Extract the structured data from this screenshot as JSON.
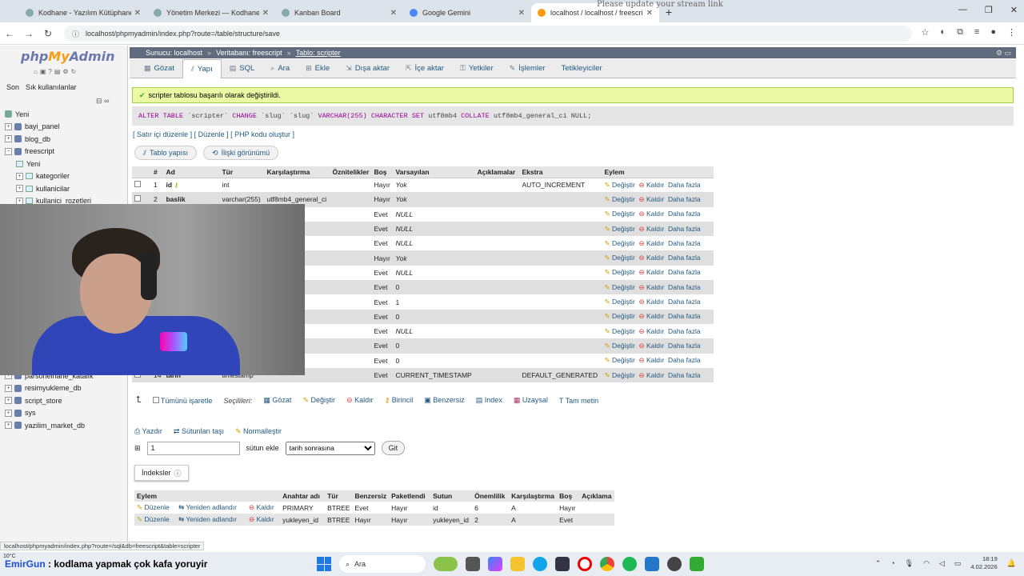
{
  "browser": {
    "tabs": [
      {
        "label": "Kodhane - Yazılım Kütüphanesi",
        "active": false
      },
      {
        "label": "Yönetim Merkezi — Kodhane",
        "active": false
      },
      {
        "label": "Kanban Board",
        "active": false
      },
      {
        "label": "Google Gemini",
        "active": false
      },
      {
        "label": "localhost / localhost / freescri",
        "active": true
      }
    ],
    "stream_note": "Please update your stream link",
    "url": "localhost/phpmyadmin/index.php?route=/table/structure/save",
    "status_url": "localhost/phpmyadmin/index.php?route=/sql&db=freescript&table=scripter"
  },
  "sidebar": {
    "logo_php": "php",
    "logo_my": "My",
    "logo_admin": "Admin",
    "tab_recent": "Son",
    "tab_favorites": "Sık kullanılanlar",
    "tree": [
      {
        "label": "Yeni",
        "level": 0,
        "type": "new"
      },
      {
        "label": "bayi_panel",
        "level": 0,
        "type": "db"
      },
      {
        "label": "blog_db",
        "level": 0,
        "type": "db"
      },
      {
        "label": "freescript",
        "level": 0,
        "type": "db"
      },
      {
        "label": "Yeni",
        "level": 1,
        "type": "new"
      },
      {
        "label": "kategoriler",
        "level": 1,
        "type": "table"
      },
      {
        "label": "kullanicilar",
        "level": 1,
        "type": "table"
      },
      {
        "label": "kullanici_rozetleri",
        "level": 1,
        "type": "table"
      }
    ],
    "tree_bottom": [
      {
        "label": "parsonelhane_katalık",
        "level": 0
      },
      {
        "label": "resimyukleme_db",
        "level": 0
      },
      {
        "label": "script_store",
        "level": 0
      },
      {
        "label": "sys",
        "level": 0
      },
      {
        "label": "yazilim_market_db",
        "level": 0
      }
    ]
  },
  "breadcrumb": {
    "server": "Sunucu: localhost",
    "database": "Veritabanı: freescript",
    "table": "Tablo: scripter"
  },
  "menu": [
    {
      "label": "Gözat",
      "icon": "▦"
    },
    {
      "label": "Yapı",
      "icon": "⫽",
      "active": true
    },
    {
      "label": "SQL",
      "icon": "▤"
    },
    {
      "label": "Ara",
      "icon": "⌕"
    },
    {
      "label": "Ekle",
      "icon": "⊞"
    },
    {
      "label": "Dışa aktar",
      "icon": "⇲"
    },
    {
      "label": "İçe aktar",
      "icon": "⇱"
    },
    {
      "label": "Yetkiler",
      "icon": "⚿"
    },
    {
      "label": "İşlemler",
      "icon": "✎"
    },
    {
      "label": "Tetikleyiciler",
      "icon": ""
    }
  ],
  "message": {
    "success": "scripter tablosu başarılı olarak değiştirildi.",
    "sql_kw1": "ALTER TABLE",
    "sql_mid1": "`scripter`",
    "sql_kw2": "CHANGE",
    "sql_mid2": "`slug` `slug`",
    "sql_type": "VARCHAR(255)",
    "sql_kw3": "CHARACTER SET",
    "sql_mid3": "utf8mb4",
    "sql_kw4": "COLLATE",
    "sql_end": "utf8mb4_general_ci NULL;"
  },
  "sql_links": {
    "inline": "Satır içi düzenle",
    "edit": "Düzenle",
    "php": "PHP kodu oluştur"
  },
  "subtabs": {
    "structure": "Tablo yapısı",
    "relation": "İlişki görünümü"
  },
  "structure": {
    "headers": [
      "#",
      "Ad",
      "Tür",
      "Karşılaştırma",
      "Öznitelikler",
      "Boş",
      "Varsayılan",
      "Açıklamalar",
      "Ekstra",
      "Eylem"
    ],
    "action_change": "Değiştir",
    "action_drop": "Kaldır",
    "action_more": "Daha fazla",
    "rows": [
      {
        "num": "1",
        "name": "id",
        "type": "int",
        "coll": "",
        "null": "Hayır",
        "def": "Yok",
        "extra": "AUTO_INCREMENT",
        "key": true
      },
      {
        "num": "2",
        "name": "baslik",
        "type": "varchar(255)",
        "coll": "utf8mb4_general_ci",
        "null": "Hayır",
        "def": "Yok",
        "extra": ""
      },
      {
        "num": "",
        "name": "",
        "type": "",
        "coll": "eral_ci",
        "null": "Evet",
        "def": "NULL",
        "extra": ""
      },
      {
        "num": "",
        "name": "",
        "type": "",
        "coll": "eral_ci",
        "null": "Evet",
        "def": "NULL",
        "extra": ""
      },
      {
        "num": "",
        "name": "",
        "type": "",
        "coll": "eral_ci",
        "null": "Evet",
        "def": "NULL",
        "extra": ""
      },
      {
        "num": "",
        "name": "",
        "type": "",
        "coll": "eral_ci",
        "null": "Hayır",
        "def": "Yok",
        "extra": ""
      },
      {
        "num": "",
        "name": "",
        "type": "",
        "coll": "",
        "null": "Evet",
        "def": "NULL",
        "extra": ""
      },
      {
        "num": "",
        "name": "",
        "type": "",
        "coll": "",
        "null": "Evet",
        "def": "0",
        "extra": ""
      },
      {
        "num": "",
        "name": "",
        "type": "",
        "coll": "",
        "null": "Evet",
        "def": "1",
        "extra": ""
      },
      {
        "num": "",
        "name": "",
        "type": "",
        "coll": "",
        "null": "Evet",
        "def": "0",
        "extra": ""
      },
      {
        "num": "",
        "name": "",
        "type": "",
        "coll": "eral_ci",
        "null": "Evet",
        "def": "NULL",
        "extra": ""
      },
      {
        "num": "",
        "name": "",
        "type": "",
        "coll": "",
        "null": "Evet",
        "def": "0",
        "extra": ""
      },
      {
        "num": "",
        "name": "",
        "type": "",
        "coll": "",
        "null": "Evet",
        "def": "0",
        "extra": ""
      },
      {
        "num": "14",
        "name": "tarih",
        "type": "timestamp",
        "coll": "",
        "null": "Evet",
        "def": "CURRENT_TIMESTAMP",
        "extra": "DEFAULT_GENERATED"
      }
    ]
  },
  "bulk": {
    "check_all": "Tümünü işaretle",
    "selected": "Seçilileri:",
    "actions": [
      "Gözat",
      "Değiştir",
      "Kaldır",
      "Birincil",
      "Benzersiz",
      "Index",
      "Uzaysal",
      "Tam metin"
    ]
  },
  "tools": {
    "print": "Yazdır",
    "move": "Sütunları taşı",
    "normalize": "Normalleştir"
  },
  "add_column": {
    "count": "1",
    "label": "sütun ekle",
    "position": "tarih sonrasına",
    "go": "Git"
  },
  "indexes": {
    "title": "İndeksler",
    "headers": [
      "Eylem",
      "",
      "",
      "Anahtar adı",
      "Tür",
      "Benzersiz",
      "Paketlendi",
      "Sutun",
      "Önemlilik",
      "Karşılaştırma",
      "Boş",
      "Açıklama"
    ],
    "edit": "Düzenle",
    "rename": "Yeniden adlandır",
    "drop": "Kaldır",
    "rows": [
      {
        "name": "PRIMARY",
        "type": "BTREE",
        "unique": "Evet",
        "packed": "Hayır",
        "column": "id",
        "card": "6",
        "coll": "A",
        "null": "Hayır"
      },
      {
        "name": "yukleyen_id",
        "type": "BTREE",
        "unique": "Hayır",
        "packed": "Hayır",
        "column": "yukleyen_id",
        "card": "2",
        "coll": "A",
        "null": "Evet"
      }
    ]
  },
  "taskbar": {
    "weather": "10°C",
    "caption_name": "EmirGun",
    "caption_text": ": kodlama yapmak çok kafa yoruyir",
    "search": "Ara",
    "time": "18:19",
    "date": "4.02.2026"
  }
}
